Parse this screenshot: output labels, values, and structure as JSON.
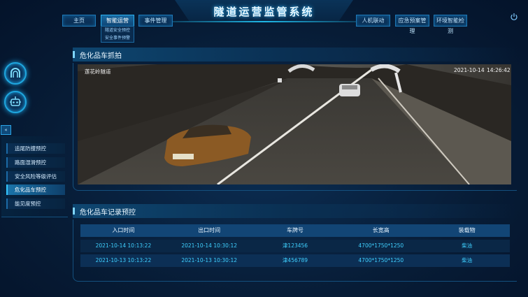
{
  "header": {
    "title": "隧道运营监管系统",
    "nav_left": [
      "主页",
      "智能运营",
      "事件管理"
    ],
    "nav_right": [
      "人机联动",
      "应急预案管理",
      "环境智能检测"
    ],
    "submenu": [
      "隧道安全预控",
      "安全事件预警"
    ]
  },
  "side": {
    "collapse_label": "«",
    "menu": [
      "追尾防撞预控",
      "路面湿滑预控",
      "安全风险等级评估",
      "危化品车预控",
      "能见度预控"
    ],
    "active_index": 3
  },
  "capture": {
    "title": "危化品车抓拍",
    "location": "莲花岭隧道",
    "date": "2021-10-14",
    "time": "14:26:42"
  },
  "records": {
    "title": "危化品车记录预控",
    "columns": [
      "入口时间",
      "出口时间",
      "车牌号",
      "长宽高",
      "装载物"
    ],
    "rows": [
      [
        "2021-10-14 10:13:22",
        "2021-10-14 10:30:12",
        "津123456",
        "4700*1750*1250",
        "柴油"
      ],
      [
        "2021-10-13 10:13:22",
        "2021-10-13 10:30:12",
        "津456789",
        "4700*1750*1250",
        "柴油"
      ]
    ]
  },
  "colors": {
    "accent": "#1fb7e6",
    "table_value": "#3fd0ff",
    "background": "#061a33"
  }
}
